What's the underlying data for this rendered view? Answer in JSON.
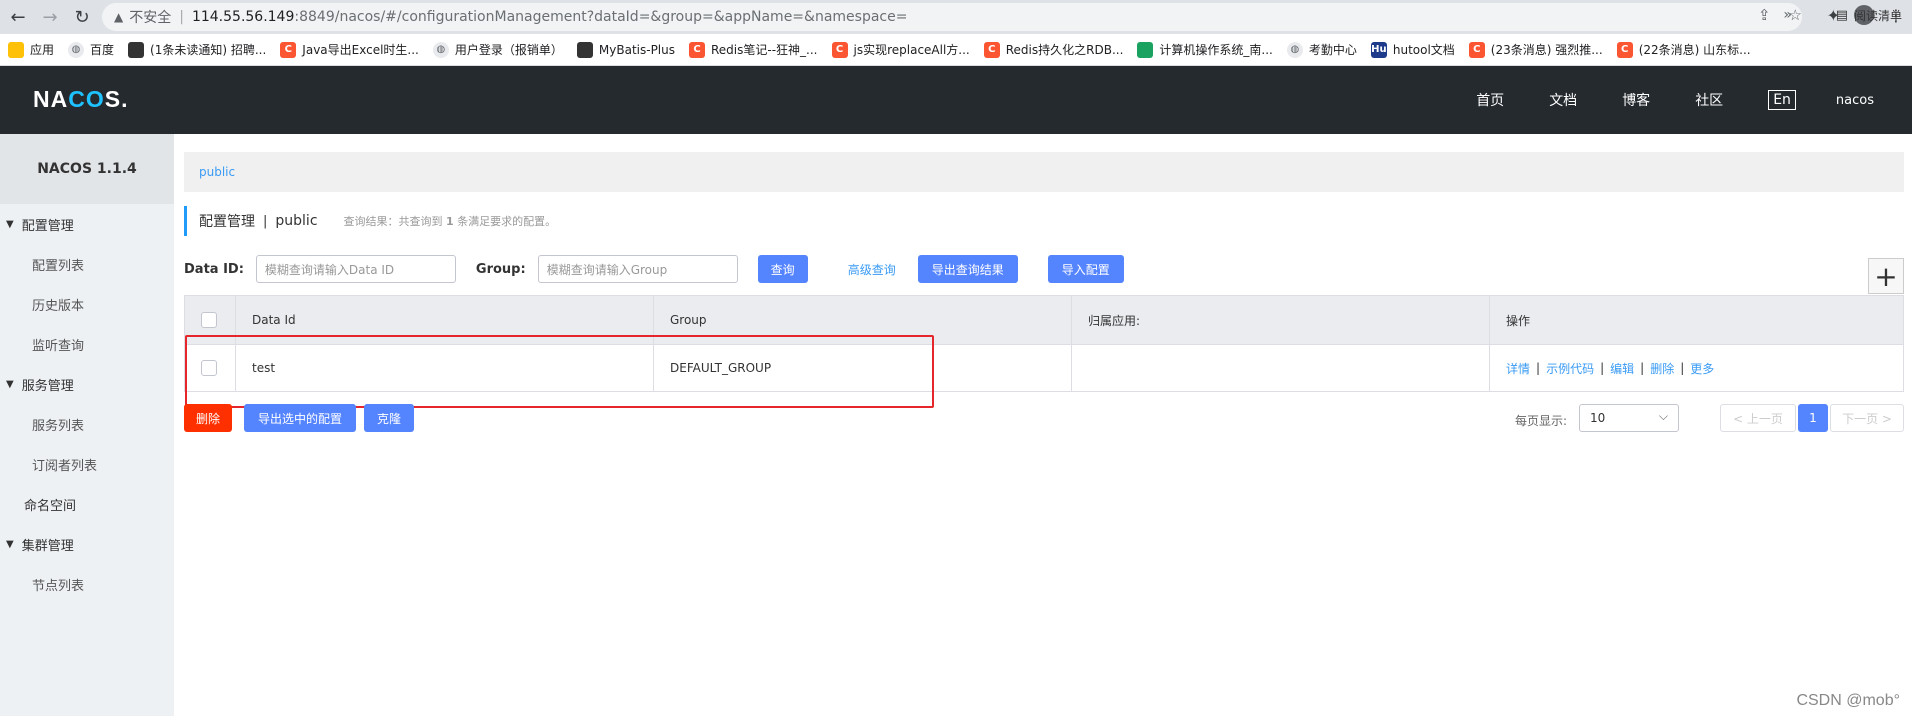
{
  "browser": {
    "security_label": "不安全",
    "url_host": "114.55.56.149",
    "url_rest": ":8849/nacos/#/configurationManagement?dataId=&group=&appName=&namespace=",
    "bookmarks": [
      {
        "icon": "grid",
        "label": "应用"
      },
      {
        "icon": "globe",
        "label": "百度"
      },
      {
        "icon": "dark",
        "label": "(1条未读通知) 招聘..."
      },
      {
        "icon": "red",
        "label": "Java导出Excel时生..."
      },
      {
        "icon": "globe",
        "label": "用户登录（报销单）"
      },
      {
        "icon": "dark",
        "label": "MyBatis-Plus"
      },
      {
        "icon": "red",
        "label": "Redis笔记--狂神_..."
      },
      {
        "icon": "red",
        "label": "js实现replaceAll方..."
      },
      {
        "icon": "red",
        "label": "Redis持久化之RDB..."
      },
      {
        "icon": "green",
        "label": "计算机操作系统_南..."
      },
      {
        "icon": "globe",
        "label": "考勤中心"
      },
      {
        "icon": "hu",
        "label": "hutool文档"
      },
      {
        "icon": "red",
        "label": "(23条消息) 强烈推..."
      },
      {
        "icon": "red",
        "label": "(22条消息) 山东标..."
      }
    ],
    "bookmarks_more": "»",
    "reading_list": "阅读清单"
  },
  "header": {
    "logo_pre": "NA",
    "logo_co": "CO",
    "logo_post": "S.",
    "nav": [
      "首页",
      "文档",
      "博客",
      "社区"
    ],
    "lang": "En",
    "user": "nacos"
  },
  "sidebar": {
    "title": "NACOS 1.1.4",
    "config_group": "配置管理",
    "config_list": "配置列表",
    "history": "历史版本",
    "listener": "监听查询",
    "service_group": "服务管理",
    "service_list": "服务列表",
    "subscriber_list": "订阅者列表",
    "namespace": "命名空间",
    "cluster_group": "集群管理",
    "node_list": "节点列表"
  },
  "main": {
    "namespace_tab": "public",
    "title": "配置管理",
    "title_sep": "|",
    "title_ns": "public",
    "result_prefix": "查询结果：共查询到",
    "result_count": "1",
    "result_suffix": "条满足要求的配置。",
    "dataid_label": "Data ID:",
    "dataid_placeholder": "模糊查询请输入Data ID",
    "group_label": "Group:",
    "group_placeholder": "模糊查询请输入Group",
    "search_btn": "查询",
    "advanced_search": "高级查询",
    "export_result_btn": "导出查询结果",
    "import_btn": "导入配置",
    "plus": "+"
  },
  "table": {
    "headers": [
      "Data Id",
      "Group",
      "归属应用:",
      "操作"
    ],
    "rows": [
      {
        "data_id": "test",
        "group": "DEFAULT_GROUP",
        "app": ""
      }
    ],
    "ops": [
      "详情",
      "示例代码",
      "编辑",
      "删除",
      "更多"
    ]
  },
  "footer": {
    "delete_btn": "删除",
    "export_selected_btn": "导出选中的配置",
    "clone_btn": "克隆",
    "page_size_label": "每页显示:",
    "page_size": "10",
    "prev": "< 上一页",
    "current_page": "1",
    "next": "下一页 >"
  },
  "watermark": "CSDN @mob°"
}
